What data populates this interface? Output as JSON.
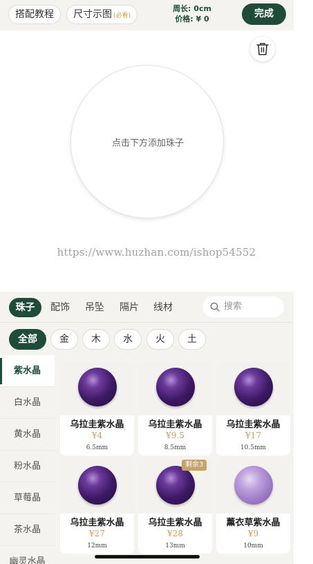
{
  "topbar": {
    "tutorial_label": "搭配教程",
    "size_guide_label": "尺寸示图",
    "size_guide_required": "(必看)",
    "length_text": "周长: 0cm",
    "price_text": "价格: ¥ 0",
    "done_label": "完成"
  },
  "canvas": {
    "hint": "点击下方添加珠子",
    "watermark": "https://www.huzhan.com/ishop54552"
  },
  "categories": {
    "tabs": [
      "珠子",
      "配饰",
      "吊坠",
      "隔片",
      "线材"
    ],
    "active": "珠子",
    "search_placeholder": "搜索"
  },
  "elements": {
    "items": [
      "全部",
      "金",
      "木",
      "水",
      "火",
      "土"
    ],
    "active": "全部"
  },
  "sidebar": {
    "items": [
      "紫水晶",
      "白水晶",
      "黄水晶",
      "粉水晶",
      "草莓晶",
      "茶水晶",
      "幽灵水晶"
    ],
    "active": "紫水晶"
  },
  "products": [
    {
      "name": "乌拉圭紫水晶",
      "price": "¥4",
      "size": "6.5mm",
      "badge": "",
      "color": "dark"
    },
    {
      "name": "乌拉圭紫水晶",
      "price": "¥9.5",
      "size": "8.5mm",
      "badge": "",
      "color": "dark"
    },
    {
      "name": "乌拉圭紫水晶",
      "price": "¥17",
      "size": "10.5mm",
      "badge": "",
      "color": "dark"
    },
    {
      "name": "乌拉圭紫水晶",
      "price": "¥27",
      "size": "12mm",
      "badge": "",
      "color": "dark"
    },
    {
      "name": "乌拉圭紫水晶",
      "price": "¥28",
      "size": "13mm",
      "badge": "剩余3",
      "color": "dark"
    },
    {
      "name": "薰衣草紫水晶",
      "price": "¥9",
      "size": "10mm",
      "badge": "",
      "color": "light"
    }
  ],
  "colors": {
    "brand_green": "#1f4b3b",
    "price_gold": "#c8a06a",
    "background": "#f5f3ef"
  }
}
